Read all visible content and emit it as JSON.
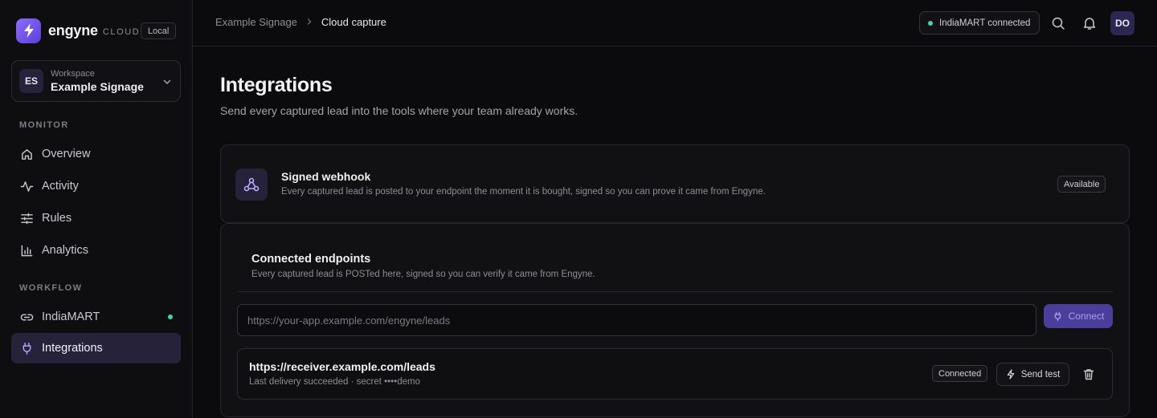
{
  "brand": {
    "name": "engyne",
    "suffix": "CLOUD",
    "env": "Local"
  },
  "workspace": {
    "initials": "ES",
    "label": "Workspace",
    "name": "Example Signage"
  },
  "sidebar": {
    "monitor_title": "MONITOR",
    "workflow_title": "WORKFLOW",
    "monitor_items": [
      {
        "label": "Overview",
        "icon": "home-icon"
      },
      {
        "label": "Activity",
        "icon": "activity-icon"
      },
      {
        "label": "Rules",
        "icon": "sliders-icon"
      },
      {
        "label": "Analytics",
        "icon": "bar-chart-icon"
      }
    ],
    "workflow_items": [
      {
        "label": "IndiaMART",
        "icon": "link-icon",
        "status": "connected"
      },
      {
        "label": "Integrations",
        "icon": "plug-icon",
        "active": true
      }
    ]
  },
  "header": {
    "breadcrumb": [
      "Example Signage",
      "Cloud capture"
    ],
    "status": "IndiaMART connected",
    "user_initials": "DO"
  },
  "page": {
    "title": "Integrations",
    "subtitle": "Send every captured lead into the tools where your team already works."
  },
  "webhook": {
    "title": "Signed webhook",
    "description": "Every captured lead is posted to your endpoint the moment it is bought, signed so you can prove it came from Engyne.",
    "badge": "Available"
  },
  "endpoints": {
    "title": "Connected endpoints",
    "description": "Every captured lead is POSTed here, signed so you can verify it came from Engyne.",
    "input_placeholder": "https://your-app.example.com/engyne/leads",
    "input_value": "",
    "connect_label": "Connect",
    "items": [
      {
        "url": "https://receiver.example.com/leads",
        "meta": "Last delivery succeeded · secret ••••demo",
        "status": "Connected",
        "send_test_label": "Send test"
      }
    ]
  },
  "colors": {
    "accent": "#5b3fd6",
    "success": "#4fd1a5",
    "background": "#0b0b0d"
  }
}
